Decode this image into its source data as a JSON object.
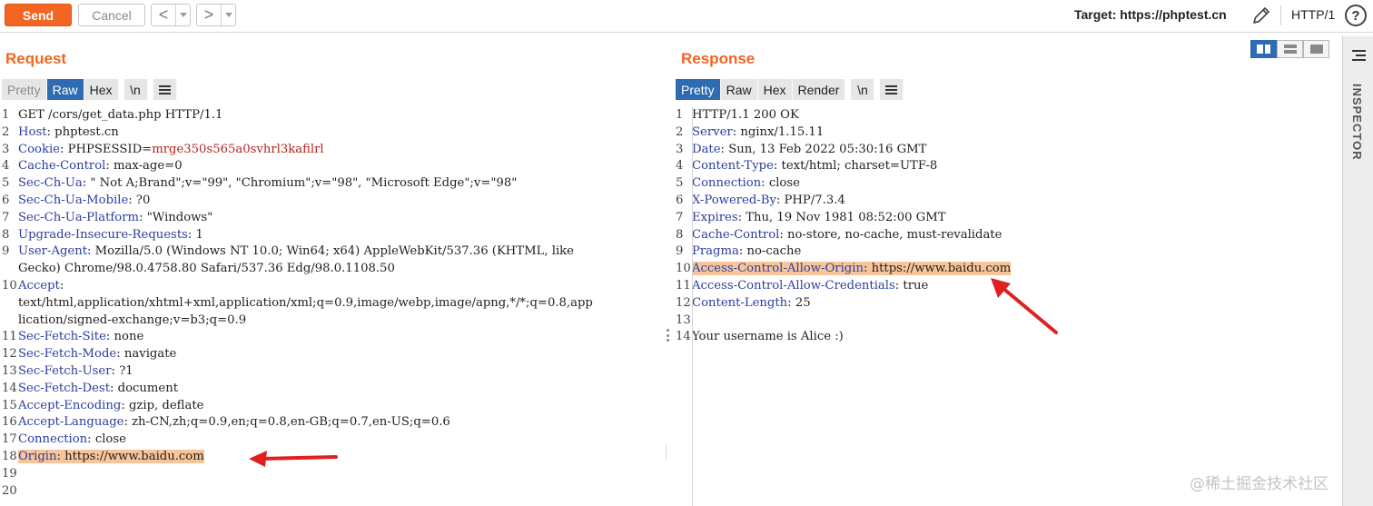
{
  "toolbar": {
    "send_label": "Send",
    "cancel_label": "Cancel",
    "back_glyph": "<",
    "forward_glyph": ">",
    "target_label": "Target: https://phptest.cn",
    "http_version": "HTTP/1",
    "help_glyph": "?"
  },
  "colors": {
    "accent": "#f26522",
    "tab_active": "#2e6bb0",
    "header_key": "#2b3ea0",
    "cookie_value": "#b5231d",
    "highlight": "#f8c59a",
    "arrow": "#e02020"
  },
  "request": {
    "title": "Request",
    "tabs": [
      "Pretty",
      "Raw",
      "Hex"
    ],
    "active_tab": "Raw",
    "newline_label": "\\n",
    "lines": [
      {
        "n": "1",
        "text": "GET /cors/get_data.php HTTP/1.1"
      },
      {
        "n": "2",
        "key": "Host",
        "value": "phptest.cn"
      },
      {
        "n": "3",
        "key": "Cookie",
        "cookie_name": "PHPSESSID",
        "cookie_value": "mrge350s565a0svhrl3kafilrl"
      },
      {
        "n": "4",
        "key": "Cache-Control",
        "value": "max-age=0"
      },
      {
        "n": "5",
        "key": "Sec-Ch-Ua",
        "value": "\" Not A;Brand\";v=\"99\", \"Chromium\";v=\"98\", \"Microsoft Edge\";v=\"98\""
      },
      {
        "n": "6",
        "key": "Sec-Ch-Ua-Mobile",
        "value": "?0"
      },
      {
        "n": "7",
        "key": "Sec-Ch-Ua-Platform",
        "value": "\"Windows\""
      },
      {
        "n": "8",
        "key": "Upgrade-Insecure-Requests",
        "value": "1"
      },
      {
        "n": "9",
        "key": "User-Agent",
        "value": "Mozilla/5.0 (Windows NT 10.0; Win64; x64) AppleWebKit/537.36 (KHTML, like",
        "cont": [
          "Gecko) Chrome/98.0.4758.80 Safari/537.36 Edg/98.0.1108.50"
        ]
      },
      {
        "n": "10",
        "key": "Accept",
        "value": "",
        "cont": [
          "text/html,application/xhtml+xml,application/xml;q=0.9,image/webp,image/apng,*/*;q=0.8,app",
          "lication/signed-exchange;v=b3;q=0.9"
        ]
      },
      {
        "n": "11",
        "key": "Sec-Fetch-Site",
        "value": "none"
      },
      {
        "n": "12",
        "key": "Sec-Fetch-Mode",
        "value": "navigate"
      },
      {
        "n": "13",
        "key": "Sec-Fetch-User",
        "value": "?1"
      },
      {
        "n": "14",
        "key": "Sec-Fetch-Dest",
        "value": "document"
      },
      {
        "n": "15",
        "key": "Accept-Encoding",
        "value": "gzip, deflate"
      },
      {
        "n": "16",
        "key": "Accept-Language",
        "value": "zh-CN,zh;q=0.9,en;q=0.8,en-GB;q=0.7,en-US;q=0.6"
      },
      {
        "n": "17",
        "key": "Connection",
        "value": "close"
      },
      {
        "n": "18",
        "key": "Origin",
        "value": "https://www.baidu.com",
        "highlight": true
      },
      {
        "n": "19",
        "text": ""
      },
      {
        "n": "20",
        "text": ""
      }
    ]
  },
  "response": {
    "title": "Response",
    "tabs": [
      "Pretty",
      "Raw",
      "Hex",
      "Render"
    ],
    "active_tab": "Pretty",
    "newline_label": "\\n",
    "lines": [
      {
        "n": "1",
        "text": "HTTP/1.1 200 OK"
      },
      {
        "n": "2",
        "key": "Server",
        "value": "nginx/1.15.11"
      },
      {
        "n": "3",
        "key": "Date",
        "value": "Sun, 13 Feb 2022 05:30:16 GMT"
      },
      {
        "n": "4",
        "key": "Content-Type",
        "value": "text/html; charset=UTF-8"
      },
      {
        "n": "5",
        "key": "Connection",
        "value": "close"
      },
      {
        "n": "6",
        "key": "X-Powered-By",
        "value": "PHP/7.3.4"
      },
      {
        "n": "7",
        "key": "Expires",
        "value": "Thu, 19 Nov 1981 08:52:00 GMT"
      },
      {
        "n": "8",
        "key": "Cache-Control",
        "value": "no-store, no-cache, must-revalidate"
      },
      {
        "n": "9",
        "key": "Pragma",
        "value": "no-cache"
      },
      {
        "n": "10",
        "key": "Access-Control-Allow-Origin",
        "value": "https://www.baidu.com",
        "highlight": true
      },
      {
        "n": "11",
        "key": "Access-Control-Allow-Credentials",
        "value": "true"
      },
      {
        "n": "12",
        "key": "Content-Length",
        "value": "25"
      },
      {
        "n": "13",
        "text": ""
      },
      {
        "n": "14",
        "text": "Your username is Alice :)"
      }
    ]
  },
  "inspector": {
    "label": "INSPECTOR"
  },
  "watermark": "@稀土掘金技术社区"
}
